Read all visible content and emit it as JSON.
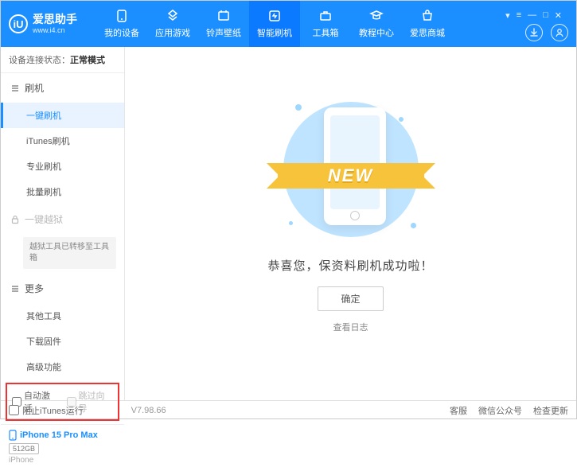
{
  "header": {
    "logo_text": "爱思助手",
    "logo_url": "www.i4.cn",
    "logo_badge": "iU",
    "nav": [
      {
        "label": "我的设备",
        "icon": "device"
      },
      {
        "label": "应用游戏",
        "icon": "apps"
      },
      {
        "label": "铃声壁纸",
        "icon": "ring"
      },
      {
        "label": "智能刷机",
        "icon": "flash",
        "active": true
      },
      {
        "label": "工具箱",
        "icon": "tools"
      },
      {
        "label": "教程中心",
        "icon": "edu"
      },
      {
        "label": "爱思商城",
        "icon": "shop"
      }
    ]
  },
  "status": {
    "label": "设备连接状态：",
    "value": "正常模式"
  },
  "sidebar": {
    "sections": [
      {
        "title": "刷机",
        "items": [
          "一键刷机",
          "iTunes刷机",
          "专业刷机",
          "批量刷机"
        ],
        "activeIndex": 0
      },
      {
        "title": "一键越狱",
        "locked": true,
        "note": "越狱工具已转移至工具箱"
      },
      {
        "title": "更多",
        "items": [
          "其他工具",
          "下载固件",
          "高级功能"
        ]
      }
    ],
    "checkboxes": {
      "auto_activate": "自动激活",
      "skip_guide": "跳过向导"
    }
  },
  "device": {
    "name": "iPhone 15 Pro Max",
    "storage": "512GB",
    "type": "iPhone"
  },
  "content": {
    "ribbon": "NEW",
    "message": "恭喜您，保资料刷机成功啦！",
    "ok_button": "确定",
    "log_link": "查看日志"
  },
  "footer": {
    "block_itunes": "阻止iTunes运行",
    "version": "V7.98.66",
    "links": [
      "客服",
      "微信公众号",
      "检查更新"
    ]
  }
}
